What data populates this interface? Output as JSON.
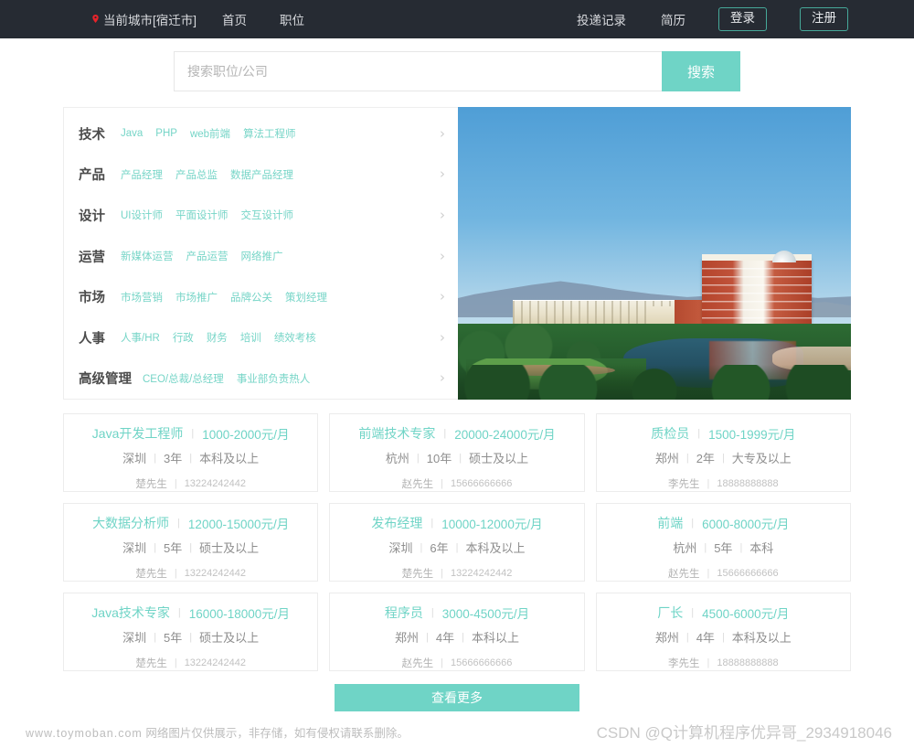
{
  "nav": {
    "city_label": "当前城市[宿迁市]",
    "pin_icon": "location-pin-icon",
    "pin_color": "#e8232a",
    "links": [
      {
        "label": "首页"
      },
      {
        "label": "职位"
      }
    ],
    "right_links": [
      {
        "label": "投递记录"
      },
      {
        "label": "简历"
      }
    ],
    "login_label": "登录",
    "register_label": "注册",
    "bg_color": "#262b33",
    "outline_color": "#46a99a"
  },
  "search": {
    "placeholder": "搜索职位/公司",
    "value": "",
    "button_label": "搜索",
    "button_color": "#6fd4c6"
  },
  "categories": [
    {
      "name": "技术",
      "tags": [
        "Java",
        "PHP",
        "web前端",
        "算法工程师"
      ],
      "chevron_icon": "chevron-right-icon"
    },
    {
      "name": "产品",
      "tags": [
        "产品经理",
        "产品总监",
        "数据产品经理"
      ],
      "chevron_icon": "chevron-right-icon"
    },
    {
      "name": "设计",
      "tags": [
        "UI设计师",
        "平面设计师",
        "交互设计师"
      ],
      "chevron_icon": "chevron-right-icon"
    },
    {
      "name": "运营",
      "tags": [
        "新媒体运营",
        "产品运营",
        "网络推广"
      ],
      "chevron_icon": "chevron-right-icon"
    },
    {
      "name": "市场",
      "tags": [
        "市场营销",
        "市场推广",
        "品牌公关",
        "策划经理"
      ],
      "chevron_icon": "chevron-right-icon"
    },
    {
      "name": "人事",
      "tags": [
        "人事/HR",
        "行政",
        "财务",
        "培训",
        "绩效考核"
      ],
      "chevron_icon": "chevron-right-icon"
    },
    {
      "name": "高级管理",
      "tags": [
        "CEO/总裁/总经理",
        "事业部负责热人"
      ],
      "chevron_icon": "chevron-right-icon"
    }
  ],
  "hero": {
    "alt": "campus-aerial-photo"
  },
  "jobs": [
    {
      "title": "Java开发工程师",
      "salary": "1000-2000元/月",
      "city": "深圳",
      "exp": "3年",
      "edu": "本科及以上",
      "contact": "楚先生",
      "phone": "13224242442"
    },
    {
      "title": "前端技术专家",
      "salary": "20000-24000元/月",
      "city": "杭州",
      "exp": "10年",
      "edu": "硕士及以上",
      "contact": "赵先生",
      "phone": "15666666666"
    },
    {
      "title": "质检员",
      "salary": "1500-1999元/月",
      "city": "郑州",
      "exp": "2年",
      "edu": "大专及以上",
      "contact": "李先生",
      "phone": "18888888888"
    },
    {
      "title": "大数据分析师",
      "salary": "12000-15000元/月",
      "city": "深圳",
      "exp": "5年",
      "edu": "硕士及以上",
      "contact": "楚先生",
      "phone": "13224242442"
    },
    {
      "title": "发布经理",
      "salary": "10000-12000元/月",
      "city": "深圳",
      "exp": "6年",
      "edu": "本科及以上",
      "contact": "楚先生",
      "phone": "13224242442"
    },
    {
      "title": "前端",
      "salary": "6000-8000元/月",
      "city": "杭州",
      "exp": "5年",
      "edu": "本科",
      "contact": "赵先生",
      "phone": "15666666666"
    },
    {
      "title": "Java技术专家",
      "salary": "16000-18000元/月",
      "city": "深圳",
      "exp": "5年",
      "edu": "硕士及以上",
      "contact": "楚先生",
      "phone": "13224242442"
    },
    {
      "title": "程序员",
      "salary": "3000-4500元/月",
      "city": "郑州",
      "exp": "4年",
      "edu": "本科以上",
      "contact": "赵先生",
      "phone": "15666666666"
    },
    {
      "title": "厂长",
      "salary": "4500-6000元/月",
      "city": "郑州",
      "exp": "4年",
      "edu": "本科及以上",
      "contact": "李先生",
      "phone": "18888888888"
    }
  ],
  "more": {
    "label": "查看更多"
  },
  "footer": {
    "domain": "www.toymoban.com",
    "disclaimer": "网络图片仅供展示，非存储，如有侵权请联系删除。",
    "watermark": "CSDN @Q计算机程序优异哥_2934918046"
  },
  "separator": "|"
}
